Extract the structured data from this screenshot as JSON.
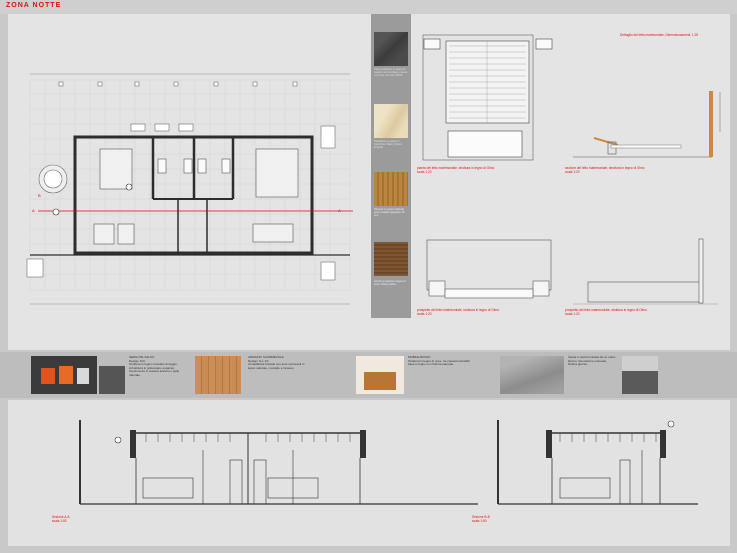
{
  "header": {
    "title": "ZONA NOTTE"
  },
  "materials": [
    {
      "name": "dark-slate-stone",
      "color": "#4b4b4b",
      "text": "Pavimentazione in pietra di basalto nero lucidata, posata a correre, formato 60x60"
    },
    {
      "name": "cream-marble",
      "color": "#e6d6b4",
      "text": "Rivestimento bagno in travertino chiaro, finitura levigata"
    },
    {
      "name": "oak-wood",
      "color": "#b37f3d",
      "text": "Parquet in rovere naturale, posa a listelli, spessore 15 mm"
    },
    {
      "name": "walnut-wood",
      "color": "#7a5230",
      "text": "Arredi su misura in legno di noce, finitura oliata"
    }
  ],
  "drawings": {
    "plan_caption_1": "pianta del letto matrimoniale, struttura in legno di Olmo",
    "plan_scale_1": "scala 1:20",
    "side_caption_1": "sezione del letto matrimoniale, struttura in legno di Olmo",
    "side_scale_1": "scala 1:20",
    "front_caption": "prospetto del letto matrimoniale, struttura in legno di Olmo",
    "front_scale": "scala 1:20",
    "side_caption_2": "prospetto del letto matrimoniale, struttura in legno di Olmo",
    "side_scale_2": "scala 1:20",
    "top_right_note": "Dettaglio del letto matrimoniale, Dimensionamenti, 1:20"
  },
  "products": [
    {
      "name": "chairs",
      "text": "SEDIA PIE SALSO\nDesign: M.F.\nStruttura in legno massello di faggio, imbottitura in poliuretano espanso, rivestimento in tessuto arancio o pelle naturale."
    },
    {
      "name": "wardrobe",
      "text": "ARMADIO SCORREVOLE\nDesign: G.L.XX\nArmadiatura frontale con ante scorrevoli in legno naturale, maniglie a incasso."
    },
    {
      "name": "cabinet",
      "text": "MOBILE BASSO\nStruttura in legno di noce, tre cassetti estraibili, base in legno con finitura naturale."
    },
    {
      "name": "stone-sink",
      "text": "Vasca in pietra ricavata da un unico blocco, lavorazione manuale, finitura grezza."
    }
  ],
  "sections": {
    "caption_a": "Sezione A-A",
    "scale_a": "scala 1:50",
    "caption_b": "Sezione B-B",
    "scale_b": "scala 1:50"
  },
  "colors": {
    "accent_red": "#d11111",
    "panel": "#e4e4e4",
    "line": "#333333"
  }
}
